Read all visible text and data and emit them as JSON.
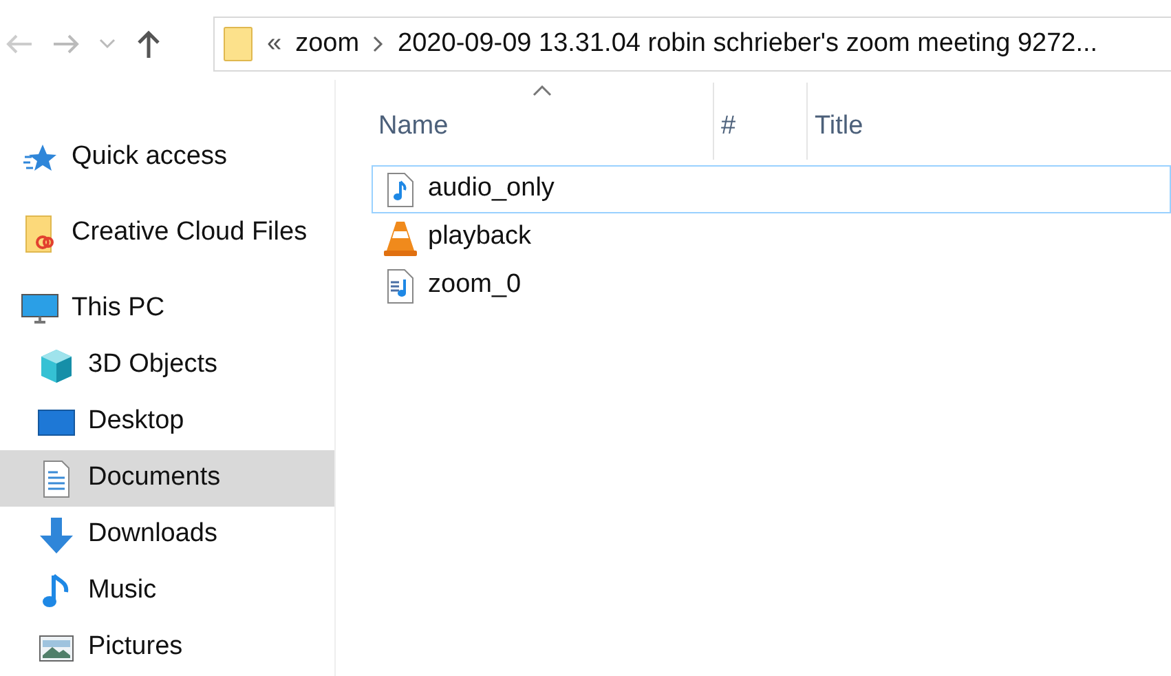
{
  "address_bar": {
    "overflow": "«",
    "segments": [
      "zoom",
      "2020-09-09 13.31.04 robin schrieber's zoom meeting 9272..."
    ]
  },
  "sidebar": {
    "items": [
      {
        "label": "Quick access",
        "selected": false
      },
      {
        "label": "Creative Cloud Files",
        "selected": false
      },
      {
        "label": "This PC",
        "selected": false,
        "children": [
          {
            "label": "3D Objects",
            "selected": false
          },
          {
            "label": "Desktop",
            "selected": false
          },
          {
            "label": "Documents",
            "selected": true
          },
          {
            "label": "Downloads",
            "selected": false
          },
          {
            "label": "Music",
            "selected": false
          },
          {
            "label": "Pictures",
            "selected": false
          }
        ]
      }
    ]
  },
  "table": {
    "columns": [
      {
        "label": "Name",
        "sorted": true
      },
      {
        "label": "#",
        "sorted": false
      },
      {
        "label": "Title",
        "sorted": false
      }
    ],
    "rows": [
      {
        "name": "audio_only",
        "focused": true
      },
      {
        "name": "playback",
        "focused": false
      },
      {
        "name": "zoom_0",
        "focused": false
      }
    ]
  }
}
